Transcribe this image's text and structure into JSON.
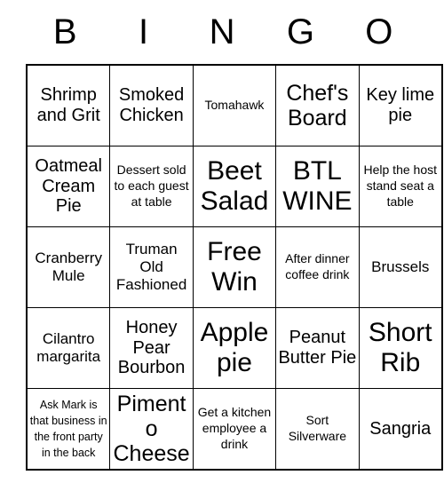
{
  "card": {
    "header_letters": [
      "B",
      "I",
      "N",
      "G",
      "O"
    ],
    "columns": 5,
    "rows": 5,
    "grid": [
      [
        {
          "text": "Shrimp and Grit",
          "size": "fs-lg"
        },
        {
          "text": "Smoked Chicken",
          "size": "fs-lg"
        },
        {
          "text": "Tomahawk",
          "size": "fs-sm"
        },
        {
          "text": "Chef's Board",
          "size": "fs-xl"
        },
        {
          "text": "Key lime pie",
          "size": "fs-lg"
        }
      ],
      [
        {
          "text": "Oatmeal Cream Pie",
          "size": "fs-lg"
        },
        {
          "text": "Dessert sold to each guest at table",
          "size": "fs-sm"
        },
        {
          "text": "Beet Salad",
          "size": "fs-xxl"
        },
        {
          "text": "BTL WINE",
          "size": "fs-xxl"
        },
        {
          "text": "Help the host stand seat a table",
          "size": "fs-sm"
        }
      ],
      [
        {
          "text": "Cranberry Mule",
          "size": "fs-md"
        },
        {
          "text": "Truman Old Fashioned",
          "size": "fs-md"
        },
        {
          "text": "Free Win",
          "size": "fs-xxl"
        },
        {
          "text": "After dinner coffee drink",
          "size": "fs-sm"
        },
        {
          "text": "Brussels",
          "size": "fs-md"
        }
      ],
      [
        {
          "text": "Cilantro margarita",
          "size": "fs-md"
        },
        {
          "text": "Honey Pear Bourbon",
          "size": "fs-lg"
        },
        {
          "text": "Apple pie",
          "size": "fs-xxl"
        },
        {
          "text": "Peanut Butter Pie",
          "size": "fs-lg"
        },
        {
          "text": "Short Rib",
          "size": "fs-xxl"
        }
      ],
      [
        {
          "text": "Ask Mark is that business in the front party in the back",
          "size": "fs-xs"
        },
        {
          "text": "Pimento Cheese",
          "size": "fs-xl"
        },
        {
          "text": "Get a kitchen employee a drink",
          "size": "fs-sm"
        },
        {
          "text": "Sort Silverware",
          "size": "fs-sm"
        },
        {
          "text": "Sangria",
          "size": "fs-lg"
        }
      ]
    ]
  }
}
